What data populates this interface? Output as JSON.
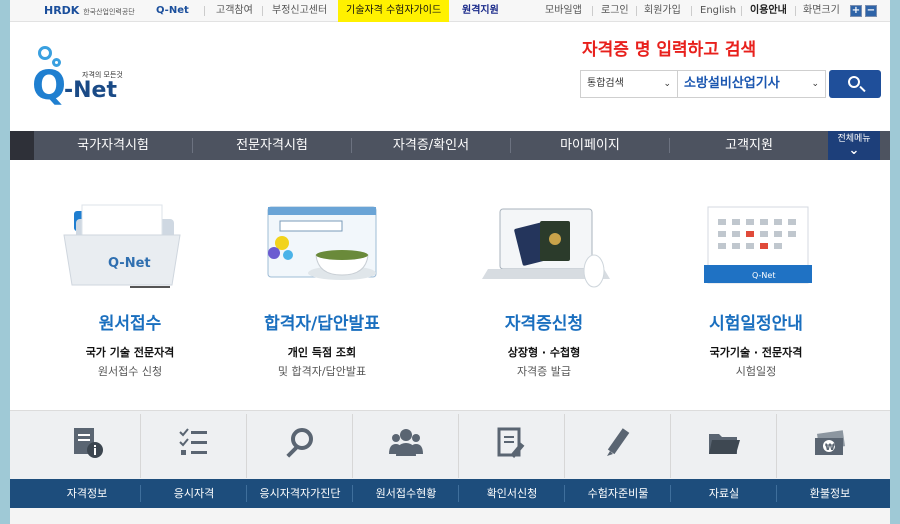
{
  "topbar": {
    "hrdk_label": "HRDK",
    "hrdk_org": "한국산업인력공단",
    "qnet_label": "Q-Net",
    "left_links": [
      "고객참여",
      "부정신고센터"
    ],
    "highlight_yellow": "기술자격 수험자가이드",
    "highlight_navy": "원격지원",
    "right_links": [
      "모바일앱",
      "로그인",
      "회원가입",
      "English",
      "이용안내",
      "화면크기"
    ],
    "zoom_plus": "+",
    "zoom_minus": "−"
  },
  "logo": {
    "tagline": "자격의 모든것",
    "q": "Q",
    "name": "-Net"
  },
  "annotation": "자격증 명 입력하고 검색",
  "search": {
    "scope": "통합검색",
    "query": "소방설비산업기사"
  },
  "gnb": {
    "items": [
      "국가자격시험",
      "전문자격시험",
      "자격증/확인서",
      "마이페이지",
      "고객지원"
    ],
    "all_menu": "전체메뉴",
    "all_menu_arrow": "⌄"
  },
  "services": [
    {
      "title": "원서접수",
      "sub1": "국가 기술 전문자격",
      "sub2": "원서접수 신청"
    },
    {
      "title": "합격자/답안발표",
      "sub1": "개인 득점 조회",
      "sub2": "및 합격자/답안발표"
    },
    {
      "title": "자격증신청",
      "sub1": "상장형 · 수첩형",
      "sub2": "자격증 발급"
    },
    {
      "title": "시험일정안내",
      "sub1": "국가기술 · 전문자격",
      "sub2": "시험일정"
    }
  ],
  "quick_menu": [
    "자격정보",
    "응시자격",
    "응시자격자가진단",
    "원서접수현황",
    "확인서신청",
    "수험자준비물",
    "자료실",
    "환불정보"
  ],
  "icons": {
    "quick": [
      "document-info-icon",
      "checklist-icon",
      "magnifier-icon",
      "people-icon",
      "edit-document-icon",
      "pen-icon",
      "folder-icon",
      "money-icon"
    ]
  },
  "colors": {
    "accent": "#1a6fbf",
    "navbar": "#4d5360",
    "quickbar": "#1d4d7c",
    "search_button": "#1f4f9a",
    "annotation": "#e8201c"
  }
}
